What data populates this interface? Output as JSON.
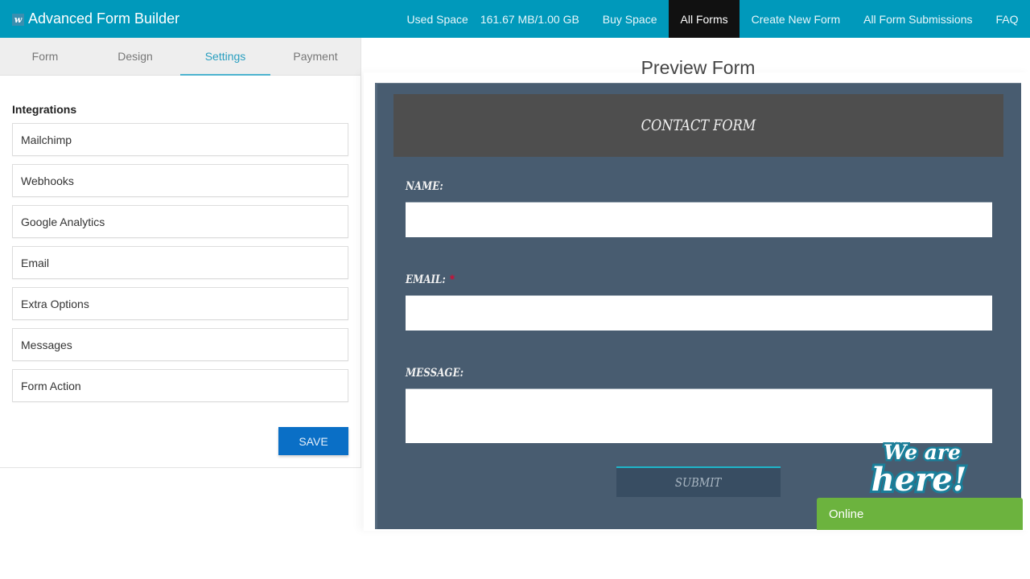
{
  "app": {
    "logo_letter": "w",
    "title": "Advanced Form Builder"
  },
  "nav": {
    "used_space_label": "Used Space",
    "used_space_value": "161.67 MB/1.00 GB",
    "items": [
      {
        "label": "Buy Space",
        "active": false
      },
      {
        "label": "All Forms",
        "active": true
      },
      {
        "label": "Create New Form",
        "active": false
      },
      {
        "label": "All Form Submissions",
        "active": false
      },
      {
        "label": "FAQ",
        "active": false
      }
    ]
  },
  "tabs": [
    {
      "label": "Form",
      "active": false
    },
    {
      "label": "Design",
      "active": false
    },
    {
      "label": "Settings",
      "active": true
    },
    {
      "label": "Payment",
      "active": false
    }
  ],
  "settings": {
    "section_title": "Integrations",
    "items": [
      {
        "label": "Mailchimp"
      },
      {
        "label": "Webhooks"
      },
      {
        "label": "Google Analytics"
      },
      {
        "label": "Email"
      },
      {
        "label": "Extra Options"
      },
      {
        "label": "Messages"
      },
      {
        "label": "Form Action"
      }
    ],
    "save_label": "SAVE"
  },
  "preview": {
    "title": "Preview Form",
    "form_title": "CONTACT FORM",
    "fields": [
      {
        "label": "NAME:",
        "required": false,
        "value": ""
      },
      {
        "label": "EMAIL:",
        "required": true,
        "value": ""
      },
      {
        "label": "MESSAGE:",
        "required": false,
        "value": ""
      }
    ],
    "required_marker": "*",
    "submit_label": "SUBMIT"
  },
  "chat": {
    "badge_line1": "We are",
    "badge_line2": "here!",
    "status": "Online"
  },
  "colors": {
    "topbar": "#0099bb",
    "active_nav": "#111111",
    "tab_active": "#2a9fc0",
    "save_button": "#0a6fc6",
    "form_bg": "#485c70",
    "form_header": "#4e4e4e",
    "submit_accent": "#1fb5c9",
    "chat_online": "#6cb33e",
    "required": "#e4002b"
  }
}
